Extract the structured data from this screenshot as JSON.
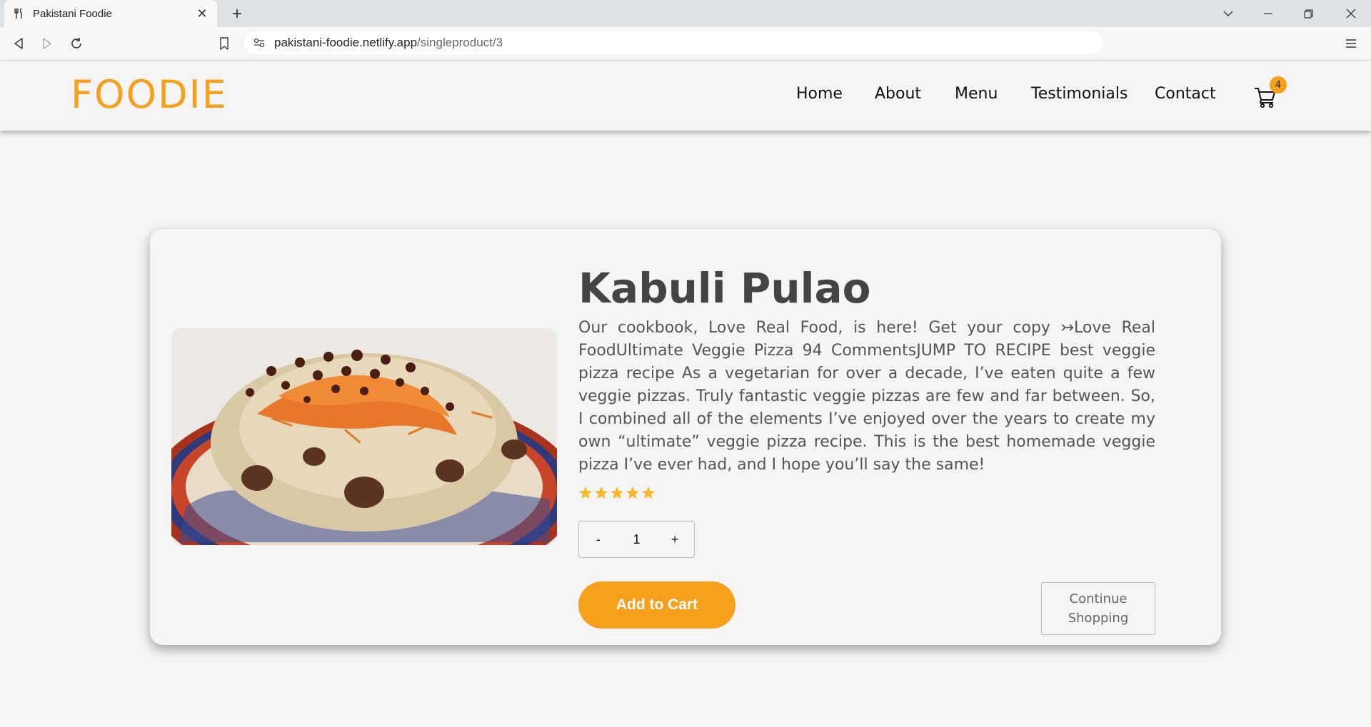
{
  "browser": {
    "tab_title": "Pakistani Foodie",
    "url_host": "pakistani-foodie.netlify.app",
    "url_path": "/singleproduct/3"
  },
  "site": {
    "logo": "FOODIE",
    "nav": [
      "Home",
      "About",
      "Menu",
      "Testimonials",
      "Contact"
    ],
    "cart_count": "4",
    "accent_color": "#f7a01c"
  },
  "product": {
    "name": "Kabuli Pulao",
    "description": "Our cookbook, Love Real Food, is here! Get your copy ↣Love Real FoodUltimate Veggie Pizza 94 CommentsJUMP TO RECIPE best veggie pizza recipe As a vegetarian for over a decade, I’ve eaten quite a few veggie pizzas. Truly fantastic veggie pizzas are few and far between. So, I combined all of the elements I’ve enjoyed over the years to create my own “ultimate” veggie pizza recipe. This is the best homemade veggie pizza I’ve ever had, and I hope you’ll say the same!",
    "rating": 5,
    "rating_max": 5,
    "quantity": {
      "minus": "-",
      "value": "1",
      "plus": "+"
    },
    "add_to_cart": "Add to Cart",
    "continue_shopping": "Continue Shopping"
  }
}
